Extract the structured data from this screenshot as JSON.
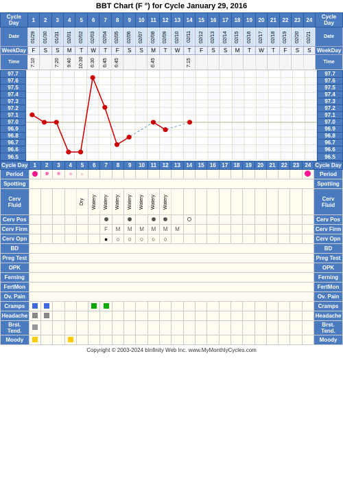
{
  "title": "BBT Chart (F °) for Cycle January 29, 2016",
  "copyright": "Copyright © 2003-2024 bInfinity Web Inc.   www.MyMonthlyCycles.com",
  "cycle_days": [
    1,
    2,
    3,
    4,
    5,
    6,
    7,
    8,
    9,
    10,
    11,
    12,
    13,
    14,
    15,
    16,
    17,
    18,
    19,
    20,
    21,
    22,
    23,
    24
  ],
  "dates": [
    "01/29",
    "01/30",
    "01/31",
    "02/01",
    "02/02",
    "02/03",
    "02/04",
    "02/05",
    "02/06",
    "02/07",
    "02/08",
    "02/09",
    "02/10",
    "02/11",
    "02/12",
    "02/13",
    "02/14",
    "02/15",
    "02/16",
    "02/17",
    "02/18",
    "02/19",
    "02/20",
    "02/21"
  ],
  "weekdays": [
    "F",
    "S",
    "S",
    "M",
    "T",
    "W",
    "T",
    "F",
    "S",
    "S",
    "M",
    "T",
    "W",
    "T",
    "F",
    "S",
    "S",
    "M",
    "T",
    "W",
    "T",
    "F",
    "S",
    "S"
  ],
  "times": [
    "7:10",
    "",
    "7:20",
    "9:40",
    "10:30",
    "6:30",
    "6:45",
    "6:45",
    "",
    "",
    "6:45",
    "",
    "",
    "7:15",
    "",
    "",
    "",
    "",
    "",
    "",
    "",
    "",
    "",
    ""
  ],
  "temps": [
    97.1,
    97.0,
    97.0,
    96.6,
    96.6,
    97.6,
    97.2,
    96.7,
    96.8,
    null,
    97.0,
    96.9,
    null,
    97.0,
    null,
    null,
    null,
    null,
    null,
    null,
    null,
    null,
    null,
    null
  ],
  "temp_labels": [
    "97.7",
    "97.6",
    "97.5",
    "97.4",
    "97.3",
    "97.2",
    "97.1",
    "97.0",
    "96.9",
    "96.8",
    "96.7",
    "96.6",
    "96.5"
  ],
  "temp_min": 96.5,
  "temp_max": 97.7,
  "period": [
    1,
    2,
    3,
    4,
    5,
    24
  ],
  "cerv_fluid": [
    "",
    "",
    "",
    "",
    "Dry",
    "Watery",
    "Watery",
    "Watery",
    "Watery",
    "Watery",
    "Watery",
    "Watery",
    "",
    "",
    "",
    "",
    "",
    "",
    "",
    "",
    "",
    "",
    "",
    ""
  ],
  "cerv_pos": [
    "",
    "",
    "",
    "",
    "",
    "",
    "1",
    "",
    "1",
    "",
    "1",
    "1",
    "",
    "1",
    "",
    "",
    "",
    "",
    "",
    "",
    "",
    "",
    "",
    ""
  ],
  "cerv_firm": [
    "",
    "",
    "",
    "",
    "",
    "",
    "F",
    "M",
    "M",
    "M",
    "M",
    "M",
    "M",
    "",
    "",
    "",
    "",
    "",
    "",
    "",
    "",
    "",
    "",
    ""
  ],
  "cerv_opn": [
    "",
    "",
    "",
    "",
    "",
    "",
    "●",
    "○",
    "○",
    "○",
    "○",
    "○",
    "",
    "",
    "",
    "",
    "",
    "",
    "",
    "",
    "",
    "",
    "",
    ""
  ],
  "cramps": [
    1,
    2,
    6,
    7
  ],
  "headache": [
    1,
    2
  ],
  "brst_tend": [
    1
  ],
  "moody": [
    1,
    4
  ],
  "labels": {
    "cycle_day": "Cycle Day",
    "date": "Date",
    "weekday": "WeekDay",
    "time": "Time",
    "period": "Period",
    "spotting": "Spotting",
    "cerv_fluid": "Cerv Fluid",
    "cerv_pos": "Cerv Pos",
    "cerv_firm": "Cerv Firm",
    "cerv_opn": "Cerv Opn",
    "bd": "BD",
    "preg_test": "Preg Test",
    "opk": "OPK",
    "ferning": "Ferning",
    "fertmon": "FertMon",
    "ov_pain": "Ov. Pain",
    "cramps": "Cramps",
    "headache": "Headache",
    "brst_tend": "Brst. Tend.",
    "moody": "Moody"
  }
}
